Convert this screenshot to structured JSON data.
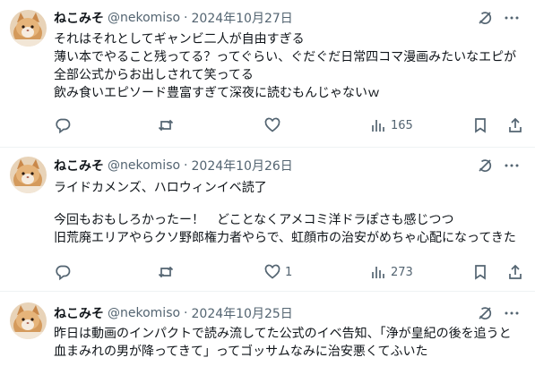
{
  "colors": {
    "text": "#0f1419",
    "secondary": "#536471",
    "divider": "#eff3f4",
    "background": "#ffffff"
  },
  "tweets": [
    {
      "author": {
        "name": "ねこみそ",
        "handle": "@nekomiso"
      },
      "separator": "·",
      "date": "2024年10月27日",
      "lines": [
        "それはそれとしてギャンビ二人が自由すぎる",
        "薄い本でやること残ってる？ってぐらい、ぐだぐだ日常四コマ漫画みたいなエピが",
        "全部公式からお出しされて笑ってる",
        "飲み食いエピソード豊富すぎて深夜に読むもんじゃないｗ"
      ],
      "actions": {
        "reply": "",
        "retweet": "",
        "like": "",
        "views": "165"
      }
    },
    {
      "author": {
        "name": "ねこみそ",
        "handle": "@nekomiso"
      },
      "separator": "·",
      "date": "2024年10月26日",
      "lines": [
        "ライドカメンズ、ハロウィンイベ読了",
        "",
        "今回もおもしろかったー！　どことなくアメコミ洋ドラぽさも感じつつ",
        "旧荒廃エリアやらクソ野郎権力者やらで、虹顔市の治安がめちゃ心配になってきた"
      ],
      "actions": {
        "reply": "",
        "retweet": "",
        "like": "1",
        "views": "273"
      }
    },
    {
      "author": {
        "name": "ねこみそ",
        "handle": "@nekomiso"
      },
      "separator": "·",
      "date": "2024年10月25日",
      "lines": [
        "昨日は動画のインパクトで読み流してた公式のイベ告知、「浄が皇紀の後を追うと",
        "血まみれの男が降ってきて」ってゴッサムなみに治安悪くてふいた"
      ]
    }
  ]
}
